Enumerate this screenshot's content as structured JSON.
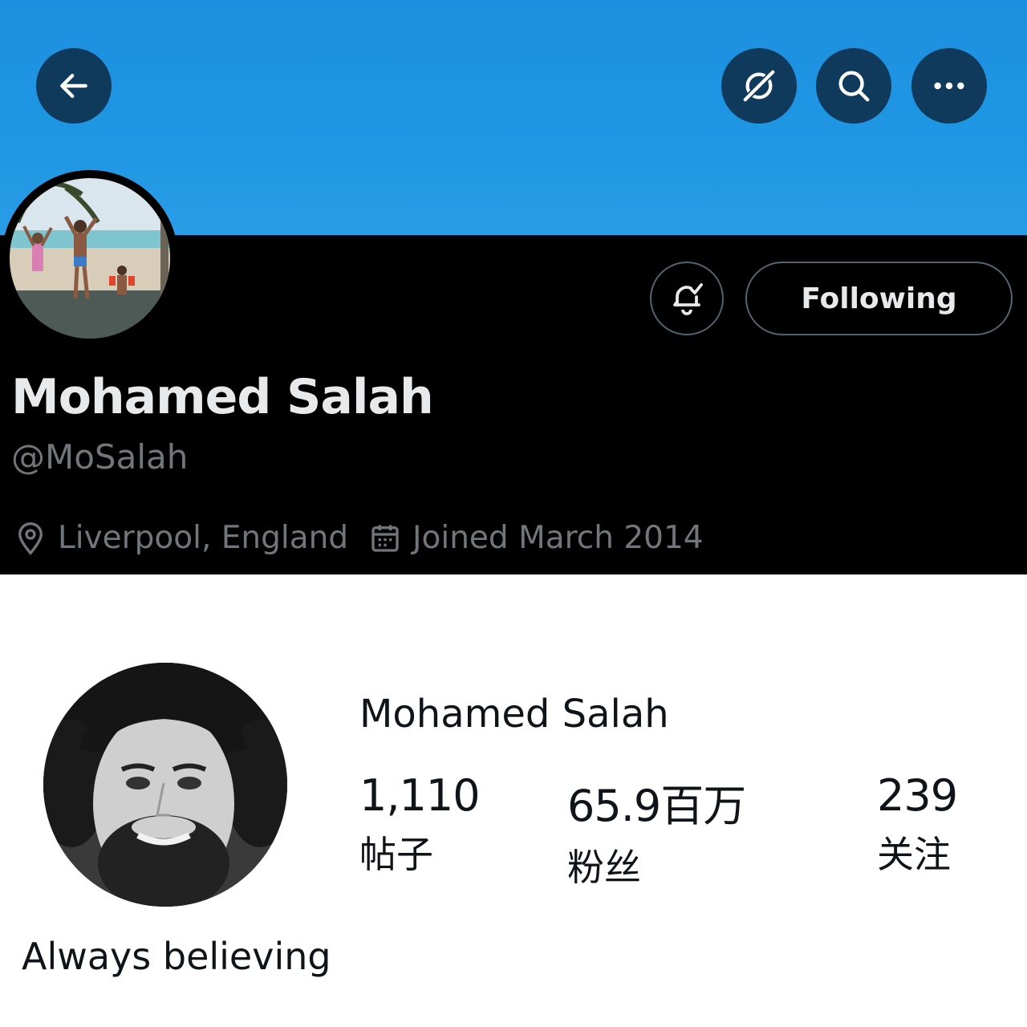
{
  "header": {
    "back_icon": "arrow-left-icon",
    "actions": [
      "grok-icon",
      "search-icon",
      "more-icon"
    ],
    "banner_color": "#1f97e3"
  },
  "profile": {
    "display_name": "Mohamed Salah",
    "handle": "@MoSalah",
    "location": "Liverpool, England",
    "joined": "Joined March 2014",
    "follow_button_label": "Following",
    "notification_icon": "bell-check-icon"
  },
  "card": {
    "name": "Mohamed Salah",
    "stats": [
      {
        "value": "1,110",
        "label": "帖子"
      },
      {
        "value": "65.9百万",
        "label": "粉丝"
      },
      {
        "value": "239",
        "label": "关注"
      }
    ],
    "bio": "Always believing"
  }
}
